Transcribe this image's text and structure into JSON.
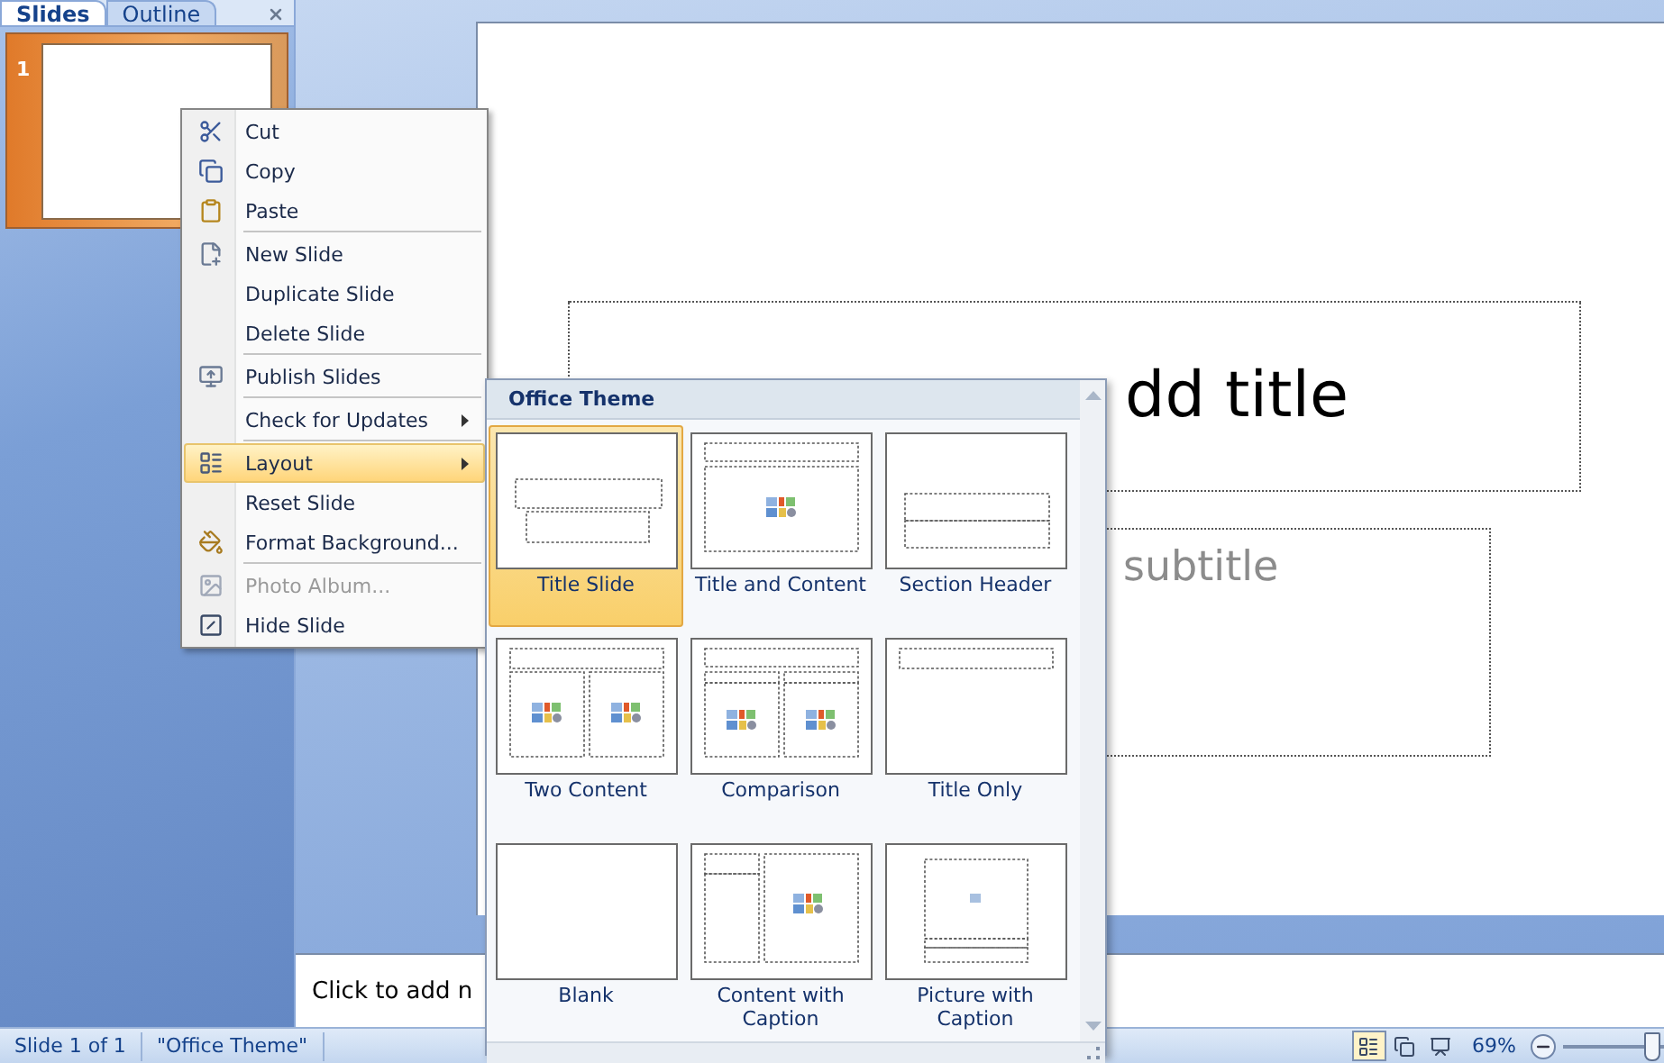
{
  "left_pane": {
    "tabs": [
      {
        "label": "Slides",
        "selected": true
      },
      {
        "label": "Outline",
        "selected": false
      }
    ],
    "thumbnails": [
      {
        "number": "1",
        "selected": true
      }
    ]
  },
  "slide": {
    "title": "dd title",
    "subtitle": "subtitle"
  },
  "notes": {
    "text": "Click to add n"
  },
  "context_menu": {
    "groups": [
      [
        {
          "label": "Cut",
          "selected": false,
          "disabled": false,
          "submenu": false
        },
        {
          "label": "Copy",
          "selected": false,
          "disabled": false,
          "submenu": false
        },
        {
          "label": "Paste",
          "selected": false,
          "disabled": false,
          "submenu": false
        }
      ],
      [
        {
          "label": "New Slide",
          "selected": false,
          "disabled": false,
          "submenu": false
        },
        {
          "label": "Duplicate Slide",
          "selected": false,
          "disabled": false,
          "submenu": false
        },
        {
          "label": "Delete Slide",
          "selected": false,
          "disabled": false,
          "submenu": false
        }
      ],
      [
        {
          "label": "Publish Slides",
          "selected": false,
          "disabled": false,
          "submenu": false
        }
      ],
      [
        {
          "label": "Check for Updates",
          "selected": false,
          "disabled": false,
          "submenu": true
        }
      ],
      [
        {
          "label": "Layout",
          "selected": true,
          "disabled": false,
          "submenu": true
        },
        {
          "label": "Reset Slide",
          "selected": false,
          "disabled": false,
          "submenu": false
        },
        {
          "label": "Format Background...",
          "selected": false,
          "disabled": false,
          "submenu": false
        }
      ],
      [
        {
          "label": "Photo Album...",
          "selected": false,
          "disabled": true,
          "submenu": false
        },
        {
          "label": "Hide Slide",
          "selected": false,
          "disabled": false,
          "submenu": false
        }
      ]
    ]
  },
  "layout_gallery": {
    "heading": "Office Theme",
    "layouts": [
      {
        "label": "Title Slide",
        "selected": true
      },
      {
        "label": "Title and Content",
        "selected": false
      },
      {
        "label": "Section Header",
        "selected": false
      },
      {
        "label": "Two Content",
        "selected": false
      },
      {
        "label": "Comparison",
        "selected": false
      },
      {
        "label": "Title Only",
        "selected": false
      },
      {
        "label": "Blank",
        "selected": false
      },
      {
        "label": "Content with Caption",
        "selected": false
      },
      {
        "label": "Picture with Caption",
        "selected": false
      }
    ]
  },
  "status_bar": {
    "slide_position": "Slide 1 of 1",
    "theme": "\"Office Theme\"",
    "views": [
      {
        "selected": true
      },
      {
        "selected": false
      },
      {
        "selected": false
      }
    ],
    "zoom": "69%",
    "zoom_slider": {
      "level": 0.88
    }
  }
}
